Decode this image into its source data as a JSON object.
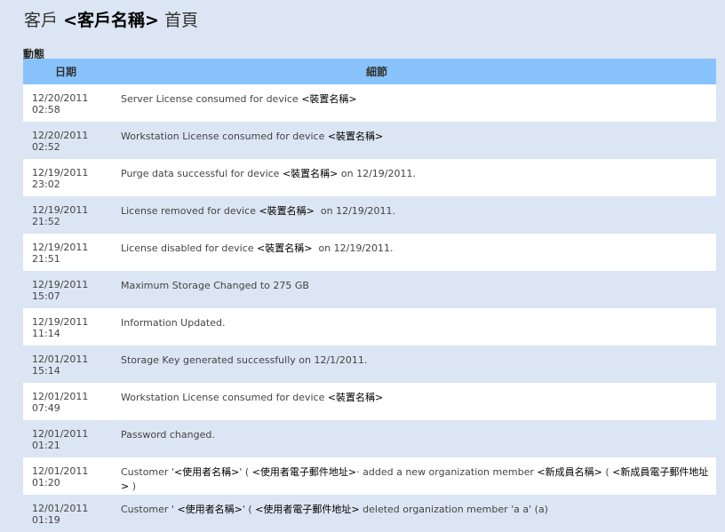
{
  "header": {
    "prefix": "客戶",
    "name": "<客戶名稱>",
    "suffix": "首頁"
  },
  "section_title": "動態",
  "columns": {
    "date": "日期",
    "details": "細節"
  },
  "rows": [
    {
      "date": "12/20/2011",
      "time": "02:58",
      "details": [
        {
          "t": "Server License consumed for device "
        },
        {
          "t": "<裝置名稱>",
          "ph": true
        }
      ]
    },
    {
      "date": "12/20/2011",
      "time": "02:52",
      "details": [
        {
          "t": "Workstation License consumed for device "
        },
        {
          "t": "<裝置名稱>",
          "ph": true
        }
      ]
    },
    {
      "date": "12/19/2011",
      "time": "23:02",
      "details": [
        {
          "t": "Purge data successful for device "
        },
        {
          "t": "<裝置名稱>",
          "ph": true
        },
        {
          "t": " on 12/19/2011."
        }
      ]
    },
    {
      "date": "12/19/2011",
      "time": "21:52",
      "details": [
        {
          "t": "License removed for device "
        },
        {
          "t": "<裝置名稱>",
          "ph": true
        },
        {
          "t": "  on 12/19/2011."
        }
      ]
    },
    {
      "date": "12/19/2011",
      "time": "21:51",
      "details": [
        {
          "t": "License disabled for device "
        },
        {
          "t": "<裝置名稱>",
          "ph": true
        },
        {
          "t": "  on 12/19/2011."
        }
      ]
    },
    {
      "date": "12/19/2011",
      "time": "15:07",
      "details": [
        {
          "t": "Maximum Storage Changed to 275 GB"
        }
      ]
    },
    {
      "date": "12/19/2011",
      "time": "11:14",
      "details": [
        {
          "t": "Information Updated."
        }
      ]
    },
    {
      "date": "12/01/2011",
      "time": "15:14",
      "details": [
        {
          "t": "Storage Key generated successfully on 12/1/2011."
        }
      ]
    },
    {
      "date": "12/01/2011",
      "time": "07:49",
      "details": [
        {
          "t": "Workstation License consumed for device "
        },
        {
          "t": "<裝置名稱>",
          "ph": true
        }
      ]
    },
    {
      "date": "12/01/2011",
      "time": "01:21",
      "details": [
        {
          "t": "Password changed."
        }
      ]
    },
    {
      "date": "12/01/2011",
      "time": "01:20",
      "details": [
        {
          "t": "Customer '"
        },
        {
          "t": "<使用者名稱>",
          "ph": true
        },
        {
          "t": "' ( "
        },
        {
          "t": "<使用者電子郵件地址>",
          "ph": true
        },
        {
          "t": "· added a new organization member "
        },
        {
          "t": "<新成員名稱>",
          "ph": true
        },
        {
          "t": " ( "
        },
        {
          "t": "<新成員電子郵件地址>",
          "ph": true
        },
        {
          "t": " )"
        }
      ]
    },
    {
      "date": "12/01/2011",
      "time": "01:19",
      "details": [
        {
          "t": "Customer ' "
        },
        {
          "t": "<使用者名稱>",
          "ph": true
        },
        {
          "t": "' ( "
        },
        {
          "t": "<使用者電子郵件地址>",
          "ph": true
        },
        {
          "t": " deleted organization member 'a a' (a)"
        }
      ]
    }
  ]
}
